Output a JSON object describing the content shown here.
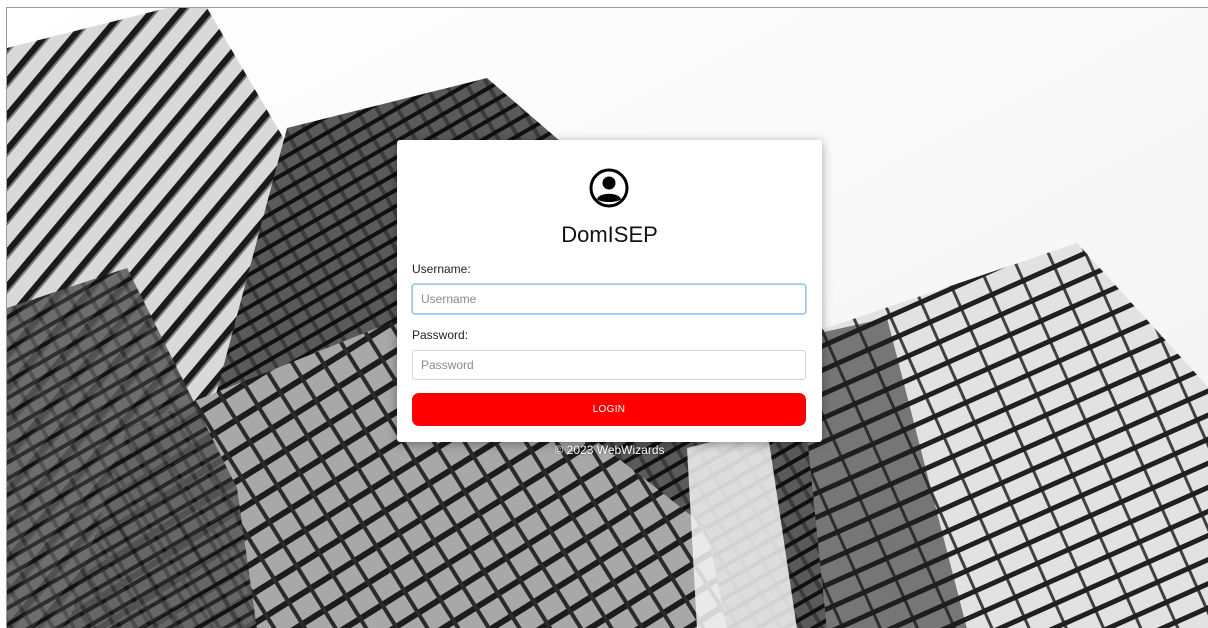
{
  "login_card": {
    "avatar_icon": "user-circle-icon",
    "title": "DomISEP",
    "username_label": "Username:",
    "username_placeholder": "Username",
    "password_label": "Password:",
    "password_placeholder": "Password",
    "login_button": "LOGIN"
  },
  "footer": {
    "copyright": "© 2023 WebWizards"
  },
  "colors": {
    "accent": "#ff0000",
    "card_background": "#ffffff",
    "focus_border": "#9ec5e8"
  }
}
